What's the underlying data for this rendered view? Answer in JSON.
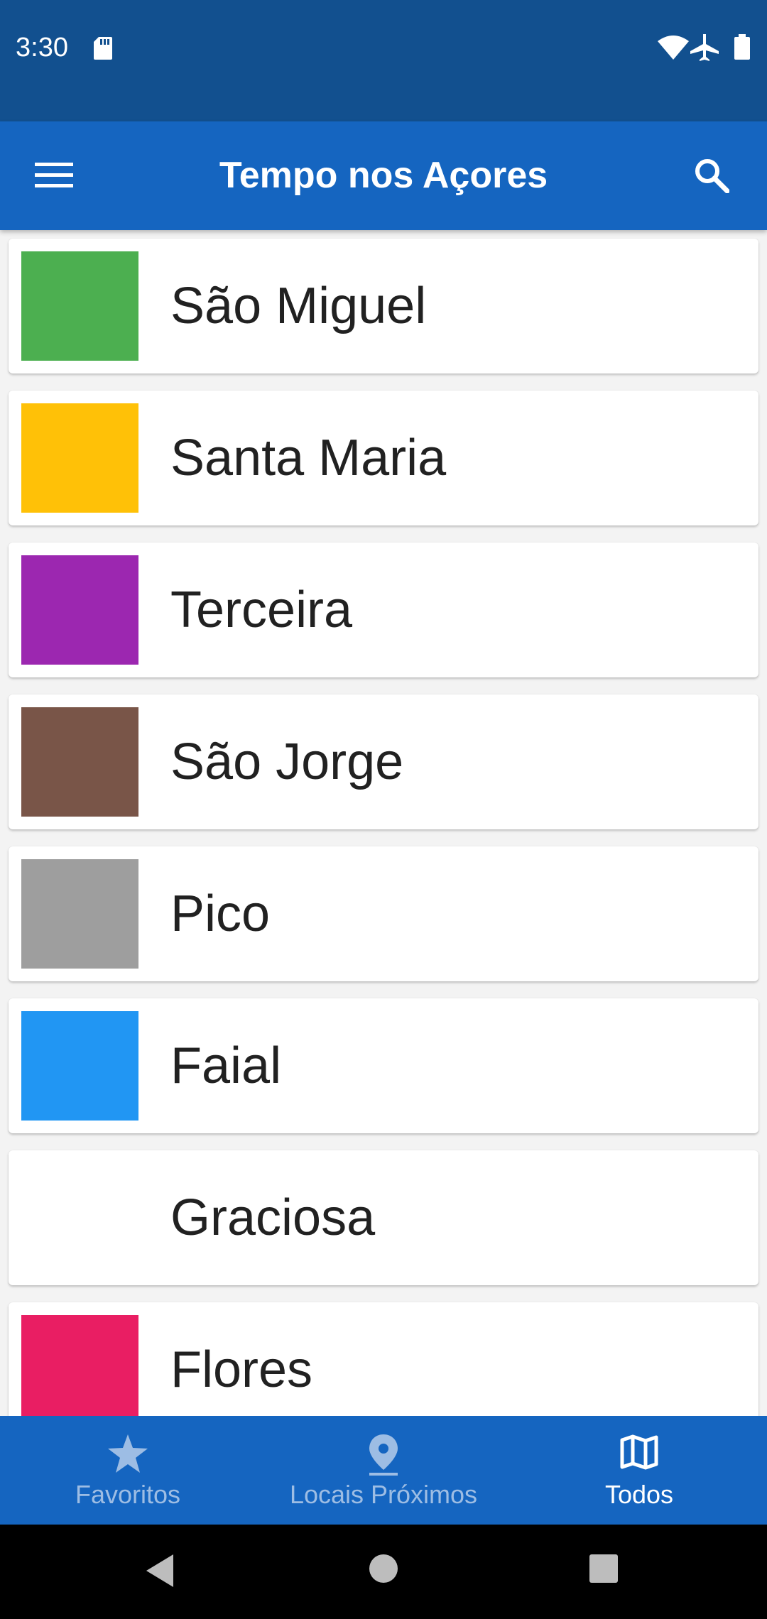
{
  "status_bar": {
    "time": "3:30",
    "icons": [
      "sd-card-icon",
      "wifi-icon",
      "airplane-icon",
      "battery-icon"
    ]
  },
  "app_bar": {
    "title": "Tempo nos Açores",
    "menu_icon": "menu-icon",
    "search_icon": "search-icon"
  },
  "islands": [
    {
      "name": "São Miguel",
      "color": "#4caf50"
    },
    {
      "name": "Santa Maria",
      "color": "#ffc107"
    },
    {
      "name": "Terceira",
      "color": "#9c27b0"
    },
    {
      "name": "São Jorge",
      "color": "#795548"
    },
    {
      "name": "Pico",
      "color": "#9e9e9e"
    },
    {
      "name": "Faial",
      "color": "#2196f3"
    },
    {
      "name": "Graciosa",
      "color": "#ffffff"
    },
    {
      "name": "Flores",
      "color": "#e91e63"
    }
  ],
  "bottom_nav": {
    "items": [
      {
        "label": "Favoritos",
        "icon": "star-icon",
        "active": false
      },
      {
        "label": "Locais Próximos",
        "icon": "location-pin-icon",
        "active": false
      },
      {
        "label": "Todos",
        "icon": "map-icon",
        "active": true
      }
    ]
  },
  "system_nav": {
    "icons": [
      "back-icon",
      "home-icon",
      "recents-icon"
    ]
  },
  "colors": {
    "status_bar": "#12508f",
    "primary": "#1565c0",
    "nav_inactive": "#9dbde4",
    "nav_active": "#ffffff"
  }
}
